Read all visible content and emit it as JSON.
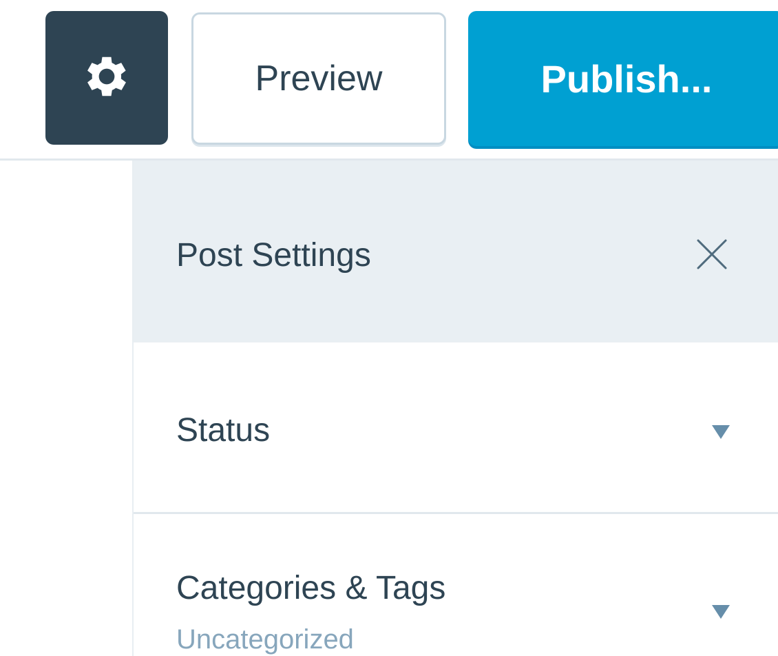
{
  "toolbar": {
    "settings_icon": "gear-icon",
    "preview_label": "Preview",
    "publish_label": "Publish...",
    "publish_color": "#00a0d2",
    "settings_bg": "#2e4453"
  },
  "sidebar": {
    "title": "Post Settings",
    "close_icon": "close-icon",
    "sections": [
      {
        "label": "Status",
        "subtitle": "",
        "icon": "caret-down-icon"
      },
      {
        "label": "Categories & Tags",
        "subtitle": "Uncategorized",
        "icon": "caret-down-icon"
      }
    ]
  }
}
